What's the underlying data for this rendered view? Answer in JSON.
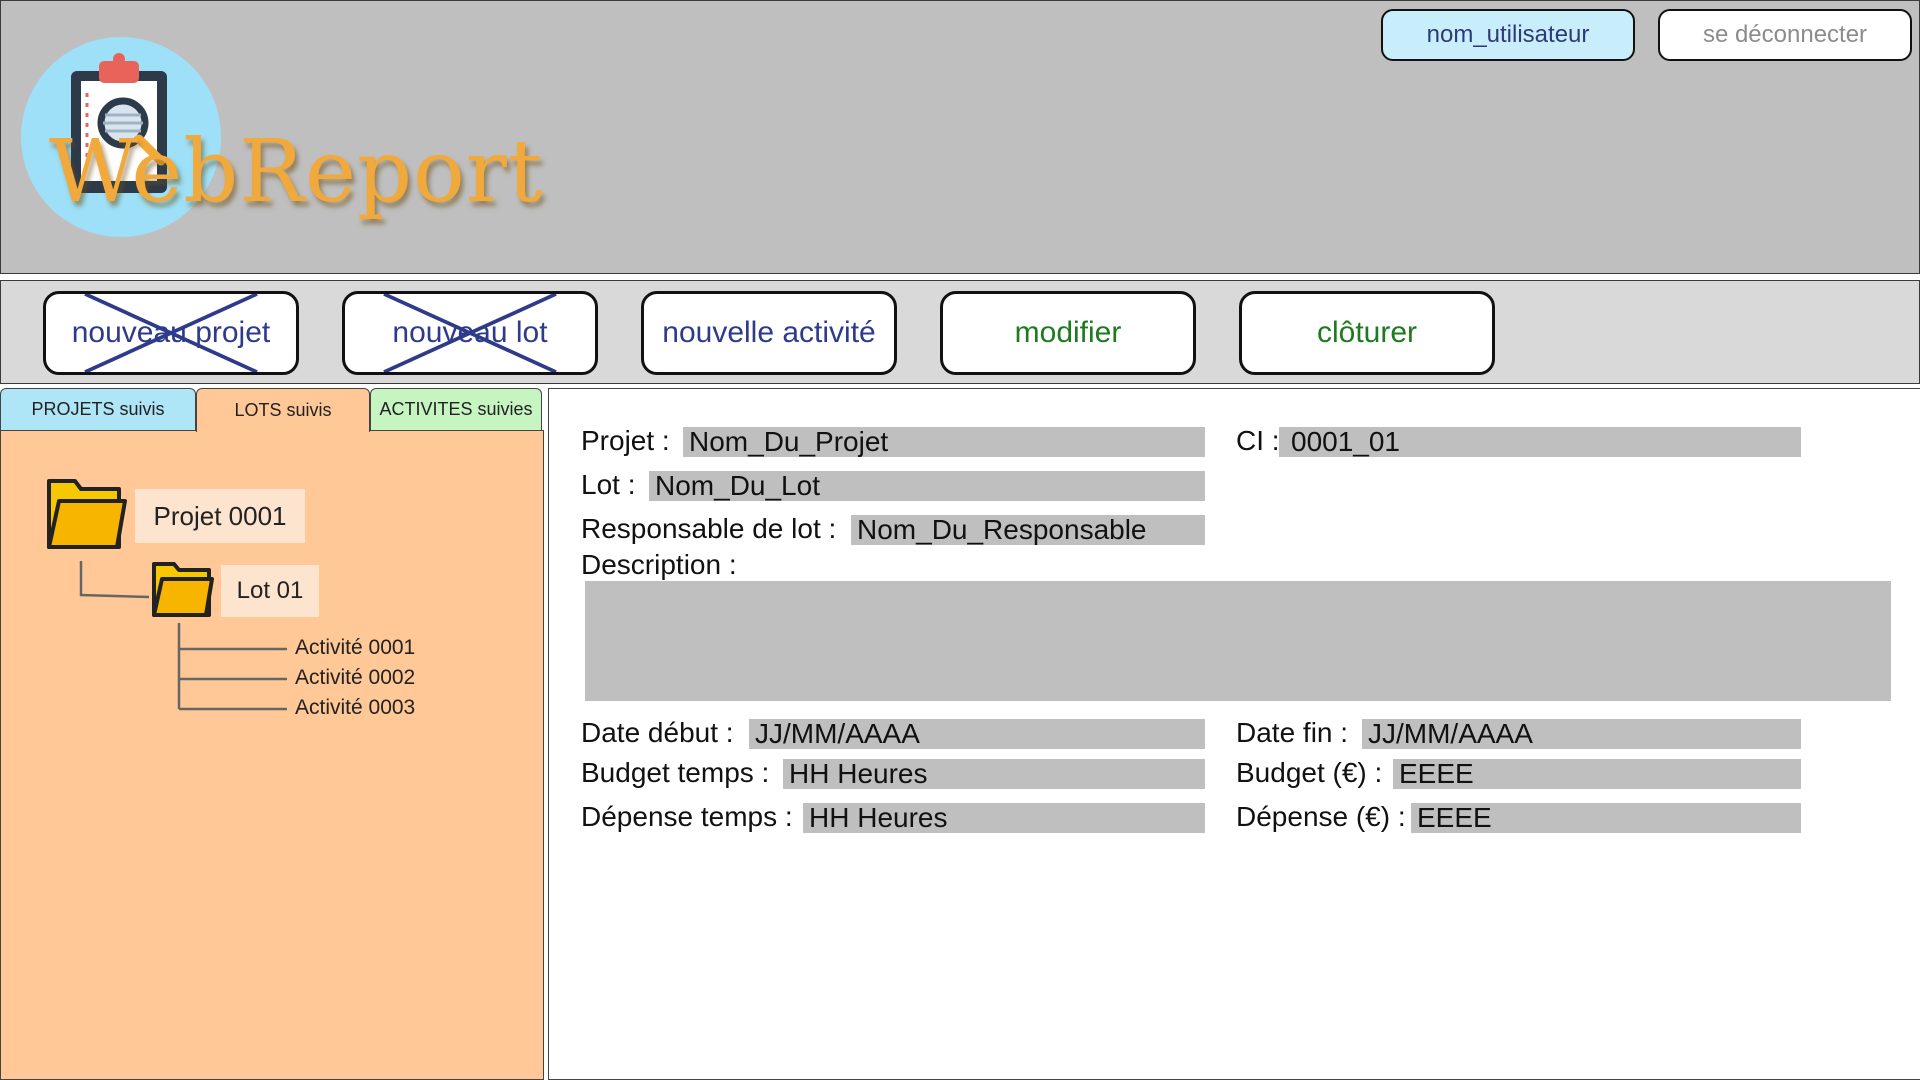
{
  "header": {
    "app_name": "WebReport",
    "user_button": "nom_utilisateur",
    "logout_button": "se déconnecter"
  },
  "toolbar": {
    "new_project": "nouveau projet",
    "new_lot": "nouveau lot",
    "new_activity": "nouvelle activité",
    "modify": "modifier",
    "close": "clôturer"
  },
  "tabs": {
    "projects": "PROJETS suivis",
    "lots": "LOTS suivis",
    "activities": "ACTIVITES suivies"
  },
  "tree": {
    "project": "Projet 0001",
    "lot": "Lot 01",
    "activities": [
      "Activité 0001",
      "Activité 0002",
      "Activité 0003"
    ]
  },
  "details": {
    "projet_label": "Projet :",
    "projet_value": "Nom_Du_Projet",
    "ci_label": "CI :",
    "ci_value": "0001_01",
    "lot_label": "Lot :",
    "lot_value": "Nom_Du_Lot",
    "responsable_label": "Responsable de lot :",
    "responsable_value": "Nom_Du_Responsable",
    "description_label": "Description :",
    "description_value": "",
    "date_debut_label": "Date début :",
    "date_debut_value": "JJ/MM/AAAA",
    "date_fin_label": "Date fin :",
    "date_fin_value": "JJ/MM/AAAA",
    "budget_temps_label": "Budget temps :",
    "budget_temps_value": "HH Heures",
    "budget_euro_label": "Budget (€) :",
    "budget_euro_value": "EEEE",
    "depense_temps_label": "Dépense temps :",
    "depense_temps_value": "HH Heures",
    "depense_euro_label": "Dépense (€) :",
    "depense_euro_value": "EEEE"
  },
  "colors": {
    "header_bg": "#bfbfbf",
    "toolbar_bg": "#d9d9d9",
    "tree_bg": "#ffc896",
    "logo_text": "#f2a93b",
    "disabled_cross": "#2e3a8a",
    "action_green": "#1e7a1e"
  }
}
